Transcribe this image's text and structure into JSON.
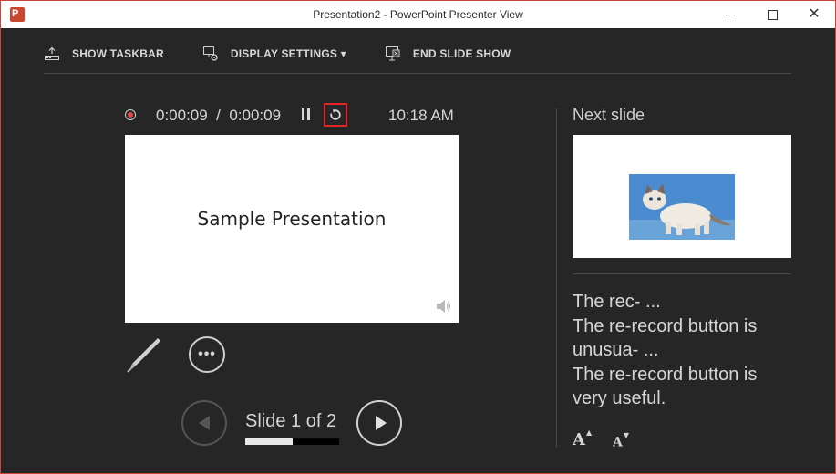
{
  "window": {
    "title": "Presentation2 - PowerPoint Presenter View",
    "app_icon_letter": "P"
  },
  "toolbar": {
    "show_taskbar": "SHOW TASKBAR",
    "display_settings": "DISPLAY SETTINGS ▾",
    "end_slide_show": "END SLIDE SHOW"
  },
  "timer": {
    "elapsed": "0:00:09  /  0:00:09",
    "clock": "10:18 AM"
  },
  "current_slide": {
    "title": "Sample Presentation"
  },
  "tools": {
    "more": "•••"
  },
  "navigation": {
    "counter": "Slide 1 of 2",
    "progress": 0.5
  },
  "next_slide": {
    "label": "Next slide"
  },
  "notes": {
    "lines": [
      "The rec- ...",
      "The re-record button is",
      "unusua- ...",
      "The re-record button is",
      "very useful."
    ]
  },
  "font_controls": {
    "increase": "A",
    "decrease": "A"
  },
  "colors": {
    "background": "#262626",
    "record_dot": "#e04848",
    "highlight_border": "#e02626"
  }
}
